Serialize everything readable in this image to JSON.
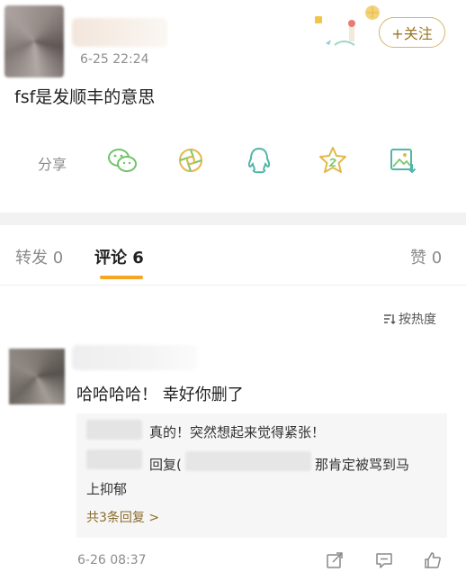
{
  "post": {
    "time": "6-25 22:24",
    "follow_label": "+关注",
    "text": "fsf是发顺丰的意思"
  },
  "share": {
    "label": "分享",
    "icons": [
      "wechat-icon",
      "moments-icon",
      "qq-icon",
      "favorite-star-icon",
      "save-image-icon"
    ]
  },
  "tabs": {
    "repost": "转发 0",
    "comments": "评论 6",
    "likes": "赞 0"
  },
  "sort": {
    "label": "按热度"
  },
  "comment": {
    "text": "哈哈哈哈！ 幸好你删了",
    "replies": {
      "r1_text": "真的！突然想起来觉得紧张！",
      "r2_prefix": "回复(",
      "r2_text": "那肯定被骂到马",
      "r2_cont": "上抑郁",
      "more": "共3条回复 >"
    },
    "time": "6-26 08:37"
  },
  "colors": {
    "accent": "#f5a623",
    "follow_border": "#d7b46a",
    "icon_green": "#7bc86c",
    "icon_gold": "#e3b84a",
    "icon_teal": "#51b6a8"
  }
}
